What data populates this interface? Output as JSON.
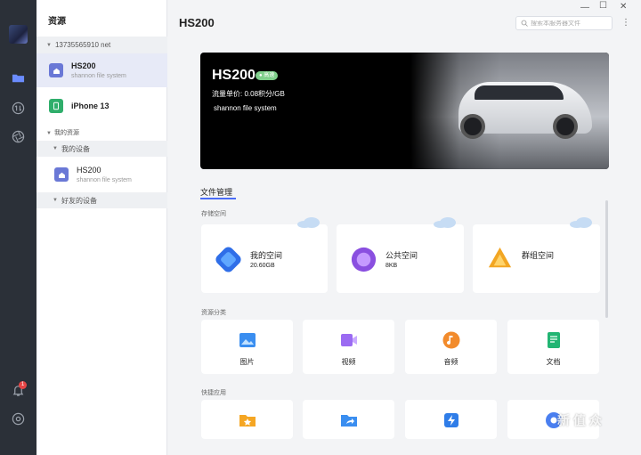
{
  "sidebar": {
    "title": "资源",
    "account_group": "13735565910 net",
    "devices": [
      {
        "name": "HS200",
        "subtitle": "shannon file system"
      },
      {
        "name": "iPhone 13"
      }
    ],
    "my_resources": "我的资源",
    "my_devices": "我的设备",
    "my_device_items": [
      {
        "name": "HS200",
        "subtitle": "shannon file system"
      }
    ],
    "friend_devices": "好友的设备"
  },
  "rail": {
    "notification_count": "1"
  },
  "header": {
    "title": "HS200",
    "search_placeholder": "搜索本服务器文件"
  },
  "hero": {
    "name": "HS200",
    "tag": "● 高速",
    "price": "流量单价: 0.08积分/GB",
    "system": "shannon file system"
  },
  "files": {
    "section_title": "文件管理",
    "storage_label": "存储空间",
    "spaces": [
      {
        "name": "我的空间",
        "size": "20.60GB"
      },
      {
        "name": "公共空间",
        "size": "8KB"
      },
      {
        "name": "群组空间",
        "size": ""
      }
    ],
    "category_label": "资源分类",
    "categories": [
      {
        "name": "图片"
      },
      {
        "name": "视频"
      },
      {
        "name": "音频"
      },
      {
        "name": "文档"
      }
    ],
    "quick_label": "快捷应用"
  },
  "colors": {
    "accent": "#4a6cf7",
    "rail_bg": "#2b3038",
    "badge": "#e54545"
  },
  "watermark": "新 值 众"
}
